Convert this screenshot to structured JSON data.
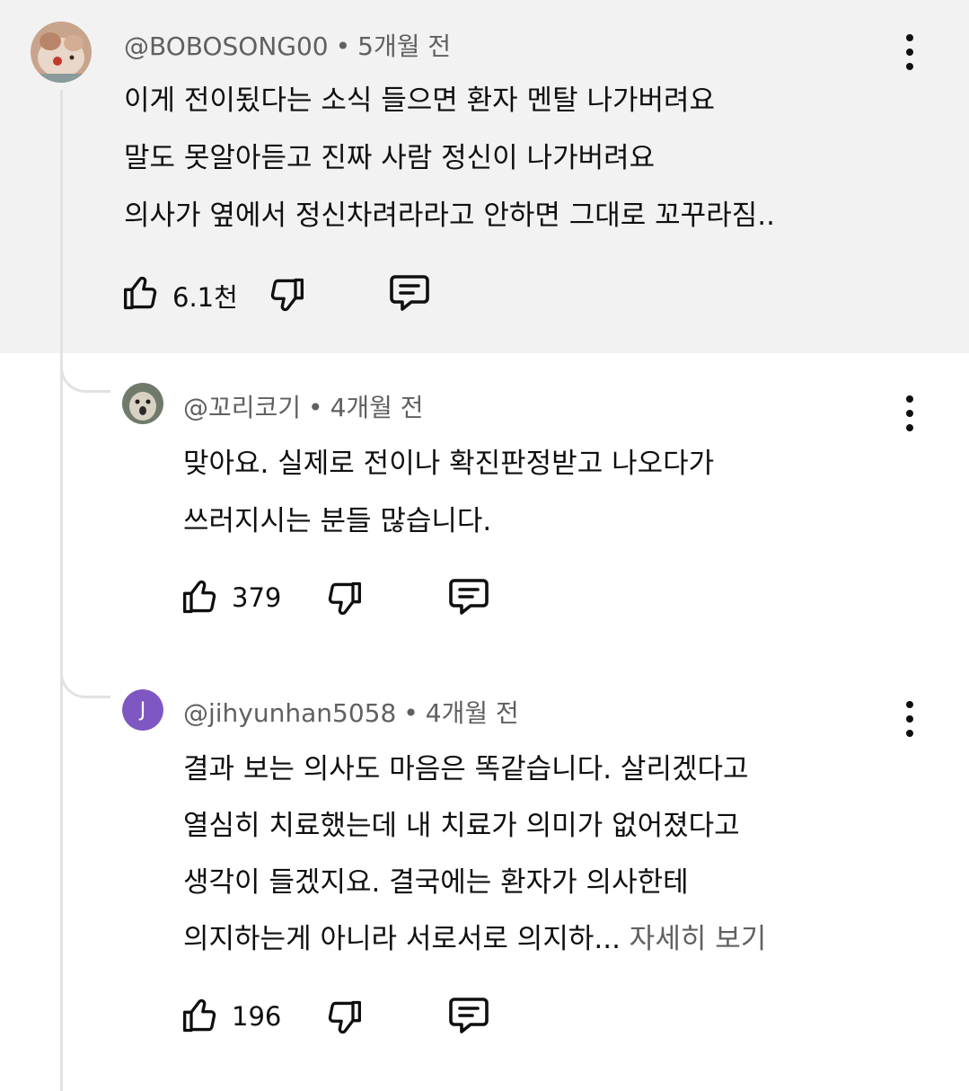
{
  "comments": [
    {
      "handle": "@BOBOSONG00",
      "separator": "•",
      "time": "5개월 전",
      "lines": [
        "이게 전이됬다는 소식 들으면 환자 멘탈 나가버려요",
        "말도 못알아듣고 진짜 사람 정신이 나가버려요",
        "의사가 옆에서 정신차려라라고 안하면 그대로 꼬꾸라짐.."
      ],
      "likes": "6.1천",
      "avatar": "cat-photo"
    },
    {
      "handle": "@꼬리코기",
      "separator": "•",
      "time": "4개월 전",
      "lines": [
        "맞아요. 실제로 전이나 확진판정받고 나오다가",
        "쓰러지시는 분들 많습니다."
      ],
      "likes": "379",
      "avatar": "dog-photo"
    },
    {
      "handle": "@jihyunhan5058",
      "separator": "•",
      "time": "4개월 전",
      "lines": [
        "결과 보는 의사도 마음은 똑같습니다. 살리겠다고",
        "열심히 치료했는데 내 치료가 의미가 없어졌다고",
        "생각이 들겠지요. 결국에는 환자가 의사한테",
        "의지하는게 아니라 서로서로 의지하..."
      ],
      "read_more": "자세히 보기",
      "likes": "196",
      "avatar_letter": "J",
      "avatar_color": "#7e57c2"
    }
  ],
  "colors": {
    "highlight_bg": "#f2f2f2",
    "secondary_text": "#606060",
    "thread_line": "#e2e2e2"
  },
  "icons": [
    "thumbs-up-icon",
    "thumbs-down-icon",
    "reply-icon",
    "more-vert-icon"
  ]
}
